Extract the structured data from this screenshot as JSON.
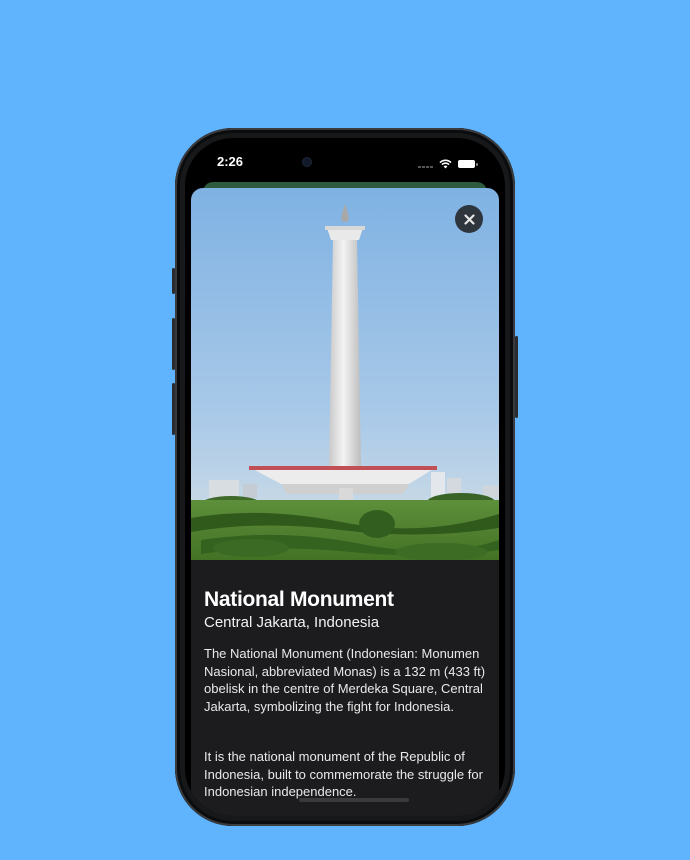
{
  "status_bar": {
    "time": "2:26"
  },
  "detail": {
    "title": "National Monument",
    "location": "Central Jakarta, Indonesia",
    "description": [
      "The National Monument (Indonesian: Monumen Nasional, abbreviated Monas) is a 132 m (433 ft) obelisk in the centre of Merdeka Square, Central Jakarta, symbolizing the fight for Indonesia.",
      "It is the national monument of the Republic of Indonesia, built to commemorate the struggle for Indonesian independence."
    ],
    "close_icon": "xmark-icon",
    "hero_image": "monument-photo"
  },
  "colors": {
    "background": "#5fb4fd",
    "sheet": "#1c1c1e",
    "sheet_behind": "#2e5a3e"
  }
}
